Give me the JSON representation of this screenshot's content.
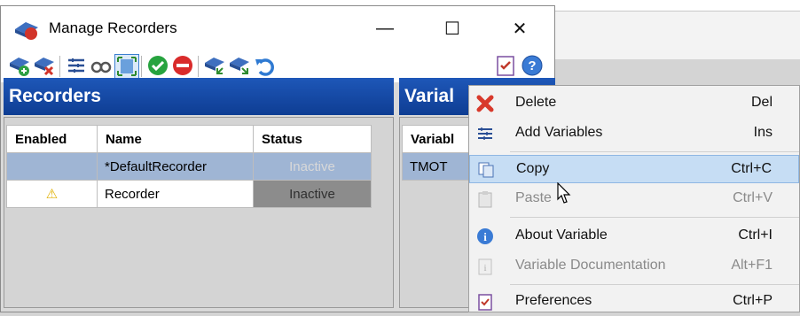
{
  "window": {
    "title": "Manage Recorders",
    "caption_buttons": {
      "minimize": "—",
      "maximize": "☐",
      "close": "✕"
    }
  },
  "toolbar": {
    "icons": [
      "add-recorder-icon",
      "remove-recorder-icon",
      "list-icon",
      "binoculars-icon",
      "fit-icon",
      "start-icon",
      "stop-icon",
      "import-icon",
      "export-icon",
      "undo-icon",
      "preferences-icon",
      "help-icon"
    ]
  },
  "recorders": {
    "title": "Recorders",
    "columns": [
      "Enabled",
      "Name",
      "Status"
    ],
    "rows": [
      {
        "enabled": "",
        "name": "*DefaultRecorder",
        "status": "Inactive"
      },
      {
        "enabled": "⚠",
        "name": "Recorder",
        "status": "Inactive"
      }
    ]
  },
  "variables": {
    "title": "Varial",
    "column": "Variabl",
    "rows": [
      "TMOT"
    ]
  },
  "context_menu": {
    "items": [
      {
        "label": "Delete",
        "shortcut": "Del",
        "icon": "delete-icon",
        "enabled": true
      },
      {
        "label": "Add Variables",
        "shortcut": "Ins",
        "icon": "add-variables-icon",
        "enabled": true
      },
      {
        "label": "Copy",
        "shortcut": "Ctrl+C",
        "icon": "copy-icon",
        "enabled": true
      },
      {
        "label": "Paste",
        "shortcut": "Ctrl+V",
        "icon": "paste-icon",
        "enabled": false
      },
      {
        "label": "About Variable",
        "shortcut": "Ctrl+I",
        "icon": "info-icon",
        "enabled": true
      },
      {
        "label": "Variable Documentation",
        "shortcut": "Alt+F1",
        "icon": "documentation-icon",
        "enabled": false
      },
      {
        "label": "Preferences",
        "shortcut": "Ctrl+P",
        "icon": "preferences-icon",
        "enabled": true
      }
    ]
  },
  "colors": {
    "panel_header": "#1e57b8",
    "selected_row": "#9fb5d4",
    "highlight": "#c6ddf4"
  }
}
